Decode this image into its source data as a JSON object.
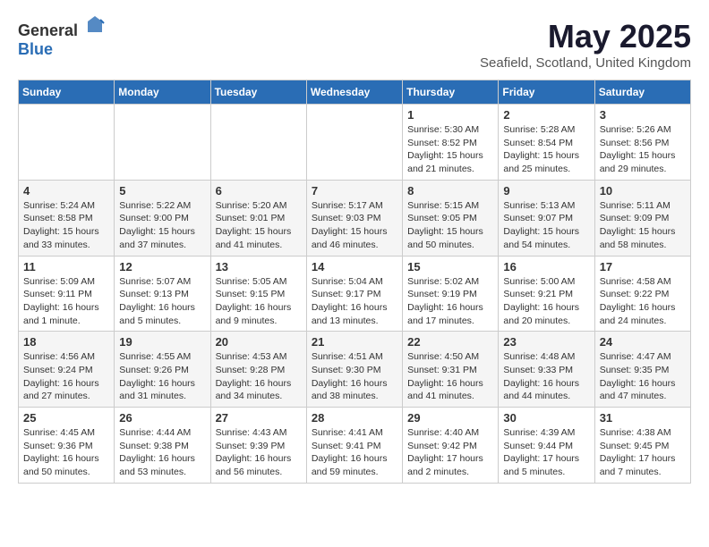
{
  "header": {
    "logo_general": "General",
    "logo_blue": "Blue",
    "title": "May 2025",
    "subtitle": "Seafield, Scotland, United Kingdom"
  },
  "weekdays": [
    "Sunday",
    "Monday",
    "Tuesday",
    "Wednesday",
    "Thursday",
    "Friday",
    "Saturday"
  ],
  "weeks": [
    [
      {
        "day": "",
        "info": ""
      },
      {
        "day": "",
        "info": ""
      },
      {
        "day": "",
        "info": ""
      },
      {
        "day": "",
        "info": ""
      },
      {
        "day": "1",
        "info": "Sunrise: 5:30 AM\nSunset: 8:52 PM\nDaylight: 15 hours\nand 21 minutes."
      },
      {
        "day": "2",
        "info": "Sunrise: 5:28 AM\nSunset: 8:54 PM\nDaylight: 15 hours\nand 25 minutes."
      },
      {
        "day": "3",
        "info": "Sunrise: 5:26 AM\nSunset: 8:56 PM\nDaylight: 15 hours\nand 29 minutes."
      }
    ],
    [
      {
        "day": "4",
        "info": "Sunrise: 5:24 AM\nSunset: 8:58 PM\nDaylight: 15 hours\nand 33 minutes."
      },
      {
        "day": "5",
        "info": "Sunrise: 5:22 AM\nSunset: 9:00 PM\nDaylight: 15 hours\nand 37 minutes."
      },
      {
        "day": "6",
        "info": "Sunrise: 5:20 AM\nSunset: 9:01 PM\nDaylight: 15 hours\nand 41 minutes."
      },
      {
        "day": "7",
        "info": "Sunrise: 5:17 AM\nSunset: 9:03 PM\nDaylight: 15 hours\nand 46 minutes."
      },
      {
        "day": "8",
        "info": "Sunrise: 5:15 AM\nSunset: 9:05 PM\nDaylight: 15 hours\nand 50 minutes."
      },
      {
        "day": "9",
        "info": "Sunrise: 5:13 AM\nSunset: 9:07 PM\nDaylight: 15 hours\nand 54 minutes."
      },
      {
        "day": "10",
        "info": "Sunrise: 5:11 AM\nSunset: 9:09 PM\nDaylight: 15 hours\nand 58 minutes."
      }
    ],
    [
      {
        "day": "11",
        "info": "Sunrise: 5:09 AM\nSunset: 9:11 PM\nDaylight: 16 hours\nand 1 minute."
      },
      {
        "day": "12",
        "info": "Sunrise: 5:07 AM\nSunset: 9:13 PM\nDaylight: 16 hours\nand 5 minutes."
      },
      {
        "day": "13",
        "info": "Sunrise: 5:05 AM\nSunset: 9:15 PM\nDaylight: 16 hours\nand 9 minutes."
      },
      {
        "day": "14",
        "info": "Sunrise: 5:04 AM\nSunset: 9:17 PM\nDaylight: 16 hours\nand 13 minutes."
      },
      {
        "day": "15",
        "info": "Sunrise: 5:02 AM\nSunset: 9:19 PM\nDaylight: 16 hours\nand 17 minutes."
      },
      {
        "day": "16",
        "info": "Sunrise: 5:00 AM\nSunset: 9:21 PM\nDaylight: 16 hours\nand 20 minutes."
      },
      {
        "day": "17",
        "info": "Sunrise: 4:58 AM\nSunset: 9:22 PM\nDaylight: 16 hours\nand 24 minutes."
      }
    ],
    [
      {
        "day": "18",
        "info": "Sunrise: 4:56 AM\nSunset: 9:24 PM\nDaylight: 16 hours\nand 27 minutes."
      },
      {
        "day": "19",
        "info": "Sunrise: 4:55 AM\nSunset: 9:26 PM\nDaylight: 16 hours\nand 31 minutes."
      },
      {
        "day": "20",
        "info": "Sunrise: 4:53 AM\nSunset: 9:28 PM\nDaylight: 16 hours\nand 34 minutes."
      },
      {
        "day": "21",
        "info": "Sunrise: 4:51 AM\nSunset: 9:30 PM\nDaylight: 16 hours\nand 38 minutes."
      },
      {
        "day": "22",
        "info": "Sunrise: 4:50 AM\nSunset: 9:31 PM\nDaylight: 16 hours\nand 41 minutes."
      },
      {
        "day": "23",
        "info": "Sunrise: 4:48 AM\nSunset: 9:33 PM\nDaylight: 16 hours\nand 44 minutes."
      },
      {
        "day": "24",
        "info": "Sunrise: 4:47 AM\nSunset: 9:35 PM\nDaylight: 16 hours\nand 47 minutes."
      }
    ],
    [
      {
        "day": "25",
        "info": "Sunrise: 4:45 AM\nSunset: 9:36 PM\nDaylight: 16 hours\nand 50 minutes."
      },
      {
        "day": "26",
        "info": "Sunrise: 4:44 AM\nSunset: 9:38 PM\nDaylight: 16 hours\nand 53 minutes."
      },
      {
        "day": "27",
        "info": "Sunrise: 4:43 AM\nSunset: 9:39 PM\nDaylight: 16 hours\nand 56 minutes."
      },
      {
        "day": "28",
        "info": "Sunrise: 4:41 AM\nSunset: 9:41 PM\nDaylight: 16 hours\nand 59 minutes."
      },
      {
        "day": "29",
        "info": "Sunrise: 4:40 AM\nSunset: 9:42 PM\nDaylight: 17 hours\nand 2 minutes."
      },
      {
        "day": "30",
        "info": "Sunrise: 4:39 AM\nSunset: 9:44 PM\nDaylight: 17 hours\nand 5 minutes."
      },
      {
        "day": "31",
        "info": "Sunrise: 4:38 AM\nSunset: 9:45 PM\nDaylight: 17 hours\nand 7 minutes."
      }
    ]
  ]
}
